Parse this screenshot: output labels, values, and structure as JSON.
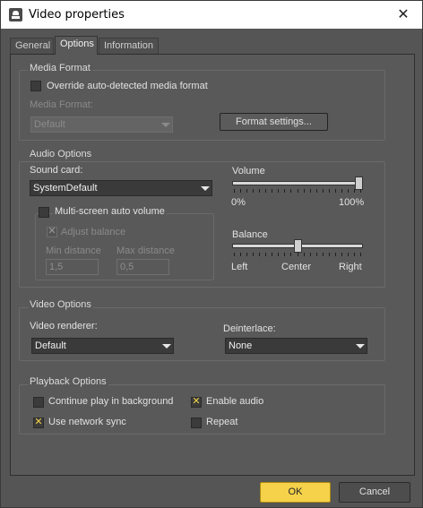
{
  "window": {
    "title": "Video properties",
    "close_glyph": "✕"
  },
  "tabs": [
    {
      "label": "General"
    },
    {
      "label": "Options"
    },
    {
      "label": "Information"
    }
  ],
  "media_format": {
    "group_title": "Media Format",
    "override_label": "Override auto-detected media format",
    "override_checked": false,
    "format_label": "Media Format:",
    "format_value": "Default",
    "format_settings_button": "Format settings..."
  },
  "audio_options": {
    "group_title": "Audio Options",
    "sound_card_label": "Sound card:",
    "sound_card_value": "SystemDefault",
    "multiscreen_label": "Multi-screen auto volume",
    "multiscreen_checked": false,
    "adjust_balance_label": "Adjust balance",
    "adjust_balance_checked": true,
    "min_distance_label": "Min distance",
    "min_distance_value": "1,5",
    "max_distance_label": "Max distance",
    "max_distance_value": "0,5",
    "volume_label": "Volume",
    "volume_min": "0%",
    "volume_max": "100%",
    "volume_level": 1.0,
    "balance_label": "Balance",
    "balance_left": "Left",
    "balance_center": "Center",
    "balance_right": "Right",
    "balance_level": 0.5
  },
  "video_options": {
    "group_title": "Video Options",
    "renderer_label": "Video renderer:",
    "renderer_value": "Default",
    "deinterlace_label": "Deinterlace:",
    "deinterlace_value": "None"
  },
  "playback_options": {
    "group_title": "Playback Options",
    "continue_label": "Continue play in background",
    "continue_checked": false,
    "network_sync_label": "Use network sync",
    "network_sync_checked": true,
    "enable_audio_label": "Enable audio",
    "enable_audio_checked": true,
    "repeat_label": "Repeat",
    "repeat_checked": false
  },
  "footer": {
    "ok_label": "OK",
    "cancel_label": "Cancel"
  },
  "colors": {
    "accent": "#f5d24a",
    "panel_bg": "#595959",
    "titlebar_bg": "#ffffff"
  }
}
